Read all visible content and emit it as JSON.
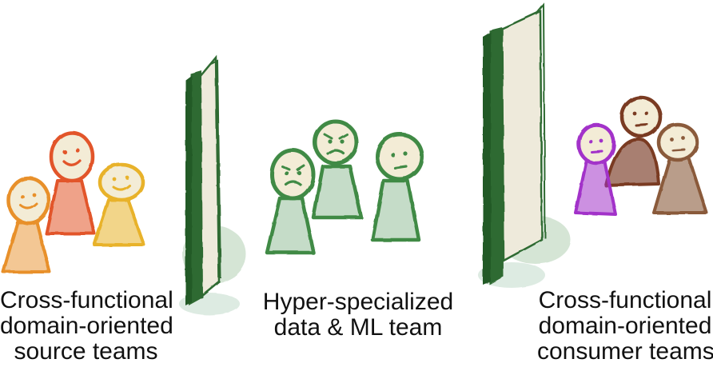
{
  "labels": {
    "source": {
      "line1": "Cross-functional",
      "line2": "domain-oriented",
      "line3": "source teams"
    },
    "ml": {
      "line1": "Hyper-specialized",
      "line2": "data & ML team"
    },
    "consumer": {
      "line1": "Cross-functional",
      "line2": "domain-oriented",
      "line3": "consumer teams"
    }
  },
  "colors": {
    "source_team": [
      "#e8902a",
      "#e2552a",
      "#e8b22a"
    ],
    "ml_team": "#3f8a45",
    "consumer_team": [
      "#a233c9",
      "#7a3a22",
      "#8a5a3a"
    ],
    "wall": "#2f6b30",
    "wall_face": "#eeeadb",
    "label_text": "#111111"
  }
}
